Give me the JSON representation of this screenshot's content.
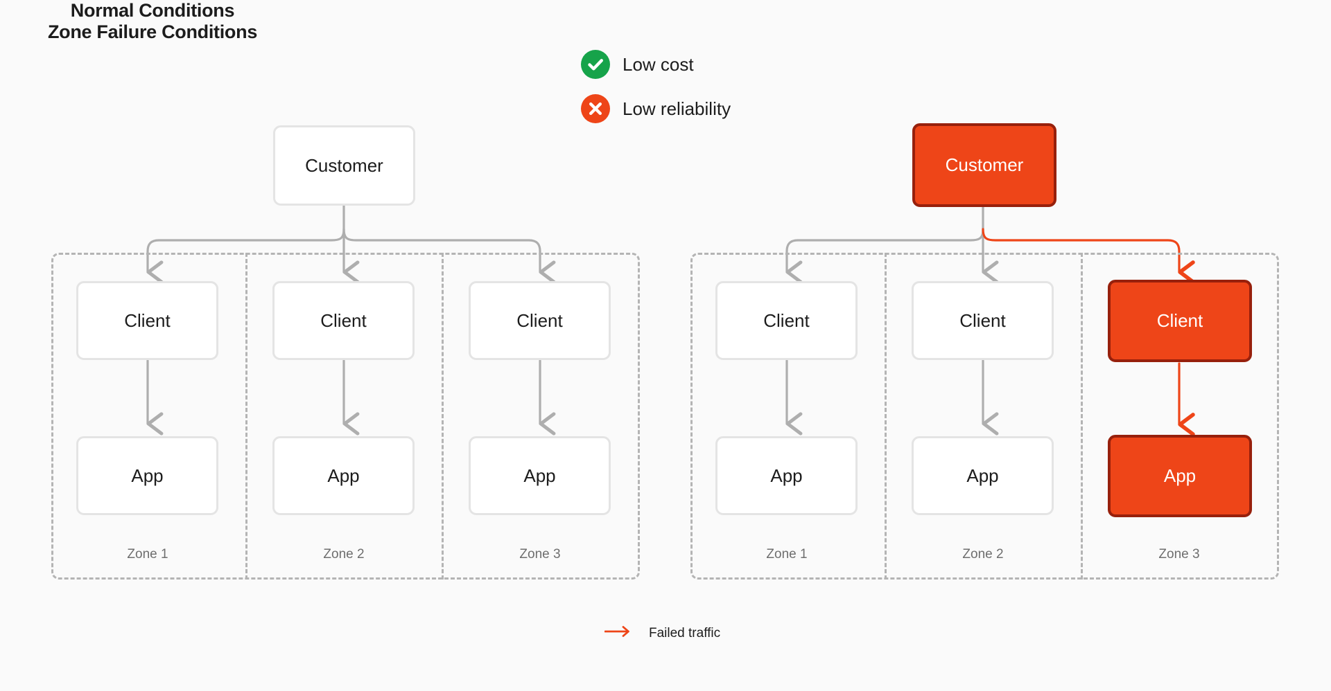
{
  "background": "#fafafa",
  "colors": {
    "accent_red": "#ee4518",
    "accent_red_border": "#97200c",
    "accent_green": "#16a34a",
    "node_border": "#e4e4e4",
    "connector_gray": "#aeaeae",
    "zone_border": "#b4b4b4",
    "text_primary": "#1c1c1c",
    "text_muted": "#6e6e6e"
  },
  "panels": [
    {
      "id": "normal",
      "title": "Normal Conditions",
      "customer": {
        "label": "Customer",
        "state": "normal"
      },
      "zones": [
        {
          "label": "Zone 1",
          "client": {
            "label": "Client",
            "state": "normal"
          },
          "app": {
            "label": "App",
            "state": "normal"
          }
        },
        {
          "label": "Zone 2",
          "client": {
            "label": "Client",
            "state": "normal"
          },
          "app": {
            "label": "App",
            "state": "normal"
          }
        },
        {
          "label": "Zone 3",
          "client": {
            "label": "Client",
            "state": "normal"
          },
          "app": {
            "label": "App",
            "state": "normal"
          }
        }
      ]
    },
    {
      "id": "failure",
      "title": "Zone Failure Conditions",
      "customer": {
        "label": "Customer",
        "state": "failed"
      },
      "zones": [
        {
          "label": "Zone 1",
          "client": {
            "label": "Client",
            "state": "normal"
          },
          "app": {
            "label": "App",
            "state": "normal"
          }
        },
        {
          "label": "Zone 2",
          "client": {
            "label": "Client",
            "state": "normal"
          },
          "app": {
            "label": "App",
            "state": "normal"
          }
        },
        {
          "label": "Zone 3",
          "client": {
            "label": "Client",
            "state": "failed"
          },
          "app": {
            "label": "App",
            "state": "failed"
          }
        }
      ]
    }
  ],
  "legend_top": [
    {
      "icon": "check-circle-icon",
      "label": "Low cost",
      "color": "#16a34a"
    },
    {
      "icon": "x-circle-icon",
      "label": "Low reliability",
      "color": "#ee4518"
    }
  ],
  "legend_bottom": [
    {
      "icon": "arrow-right-icon",
      "label": "Failed traffic",
      "color": "#ee4518"
    }
  ]
}
